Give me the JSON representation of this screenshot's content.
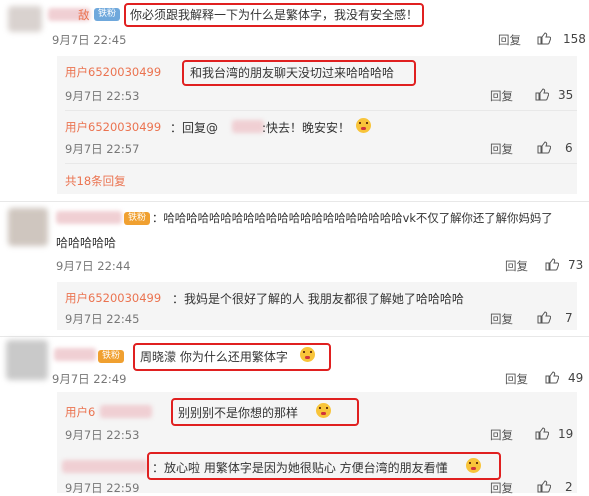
{
  "comments": [
    {
      "text": "你必须跟我解释一下为什么是繁体字，我没有安全感！",
      "badge": "铁粉",
      "time": "9月7日 22:45",
      "reply_label": "回复",
      "likes": "158"
    },
    {
      "user": "用户6520030499",
      "text": "和我台湾的朋友聊天没切过来哈哈哈哈",
      "time": "9月7日 22:53",
      "reply_label": "回复",
      "likes": "35"
    },
    {
      "user": "用户6520030499",
      "text_prefix": "：回复@",
      "text_suffix": ":快去！晚安安！",
      "time": "9月7日 22:57",
      "reply_label": "回复",
      "likes": "6"
    },
    {
      "more_link": "共18条回复"
    },
    {
      "text_line1": "：哈哈哈哈哈哈哈哈哈哈哈哈哈哈哈哈哈哈哈哈哈vk不仅了解你还了解你妈妈了",
      "text_line2": "哈哈哈哈哈",
      "badge": "铁粉",
      "time": "9月7日 22:44",
      "reply_label": "回复",
      "likes": "73"
    },
    {
      "user": "用户6520030499",
      "text": "：我妈是个很好了解的人 我朋友都很了解她了哈哈哈哈",
      "time": "9月7日 22:45",
      "reply_label": "回复",
      "likes": "7"
    },
    {
      "text": "周晓濛 你为什么还用繁体字",
      "badge": "铁粉",
      "time": "9月7日 22:49",
      "reply_label": "回复",
      "likes": "49"
    },
    {
      "user": "用户6",
      "text": "别别别不是你想的那样",
      "time": "9月7日 22:53",
      "reply_label": "回复",
      "likes": "19"
    },
    {
      "text": "：放心啦 用繁体字是因为她很贴心 方便台湾的朋友看懂",
      "time": "9月7日 22:59",
      "reply_label": "回复",
      "likes": "2"
    }
  ],
  "colors": {
    "username": "#eb7350",
    "highlight": "#e02020",
    "sub_bg": "#f5f5f5"
  },
  "icons": {
    "like": "thumbs-up-icon",
    "emoji": "grin-emoji-icon"
  }
}
